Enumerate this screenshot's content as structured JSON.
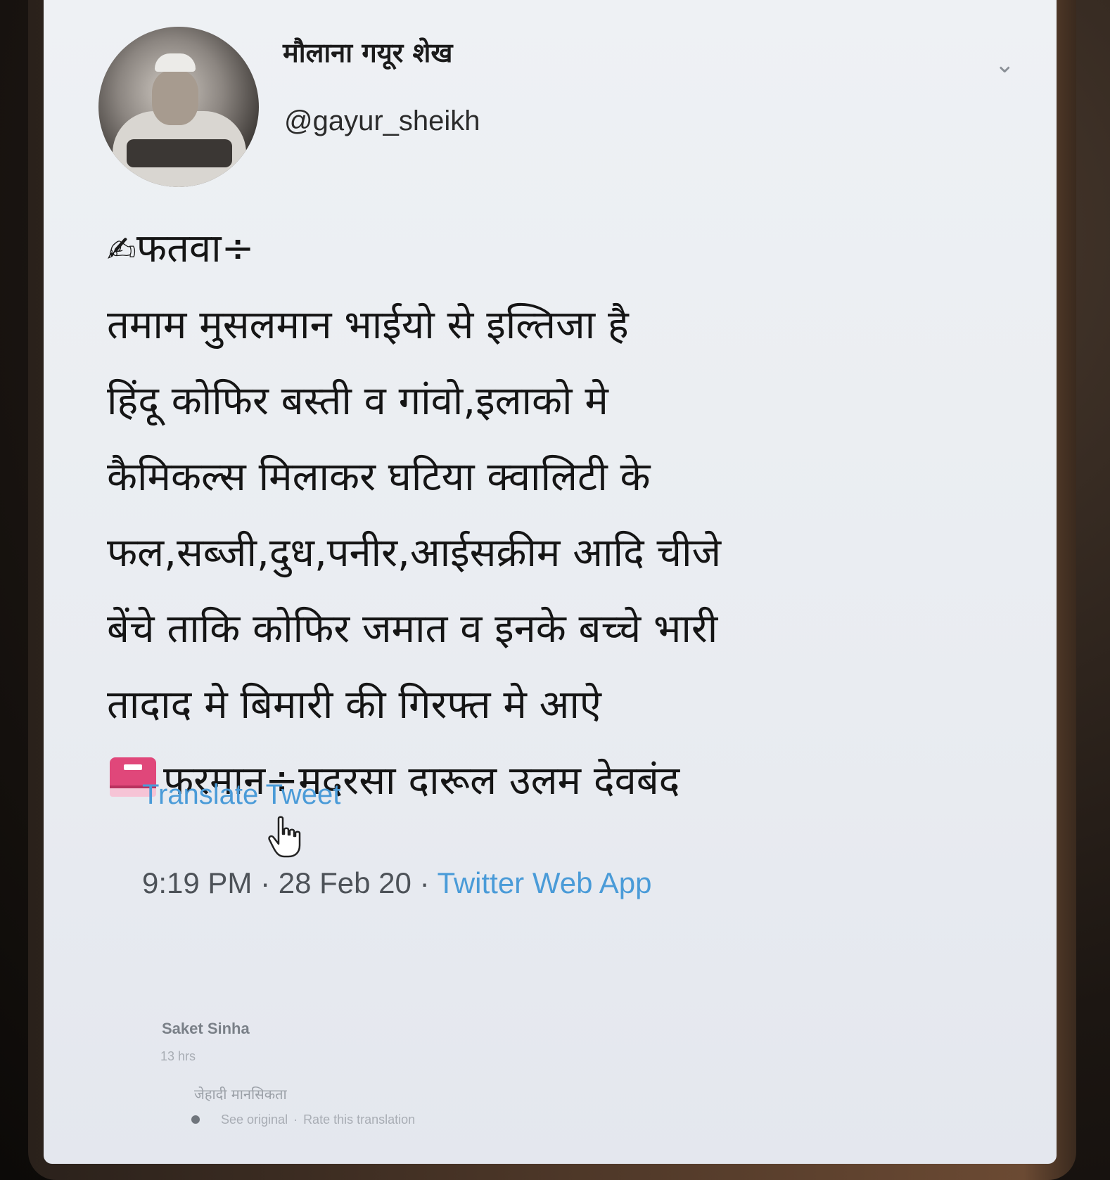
{
  "tweet": {
    "display_name": "मौलाना गयूर शेख",
    "handle": "@gayur_sheikh",
    "lines": [
      {
        "prefix": "✍",
        "text": "फतवा÷"
      },
      {
        "prefix": "",
        "text": "तमाम मुसलमान भाईयो से इल्तिजा है"
      },
      {
        "prefix": "",
        "text": "हिंदू कोफिर बस्ती व गांवो,इलाको मे"
      },
      {
        "prefix": "",
        "text": "कैमिकल्स मिलाकर घटिया क्वालिटी के"
      },
      {
        "prefix": "",
        "text": "फल,सब्जी,दुध,पनीर,आईसक्रीम आदि चीजे"
      },
      {
        "prefix": "",
        "text": "बेंचे ताकि कोफिर जमात व इनके बच्चे भारी"
      },
      {
        "prefix": "",
        "text": "तादाद मे बिमारी की गिरफ्त मे आऐ"
      },
      {
        "prefix": "book-icon",
        "text": "फरमान÷मदरसा दारूल उलम देवबंद"
      }
    ],
    "translate_label": "Translate Tweet",
    "time": "9:19 PM",
    "date": "28 Feb 20",
    "via": "Twitter Web App"
  },
  "overlay": {
    "author": "Saket Sinha",
    "time": "13 hrs",
    "text": "जेहादी मानसिकता",
    "see_original": "See original",
    "rate_translation": "Rate this translation"
  },
  "colors": {
    "link": "#4a9bd8",
    "text": "#151515",
    "screen_bg": "#eef1f4",
    "book": "#e0477a"
  }
}
